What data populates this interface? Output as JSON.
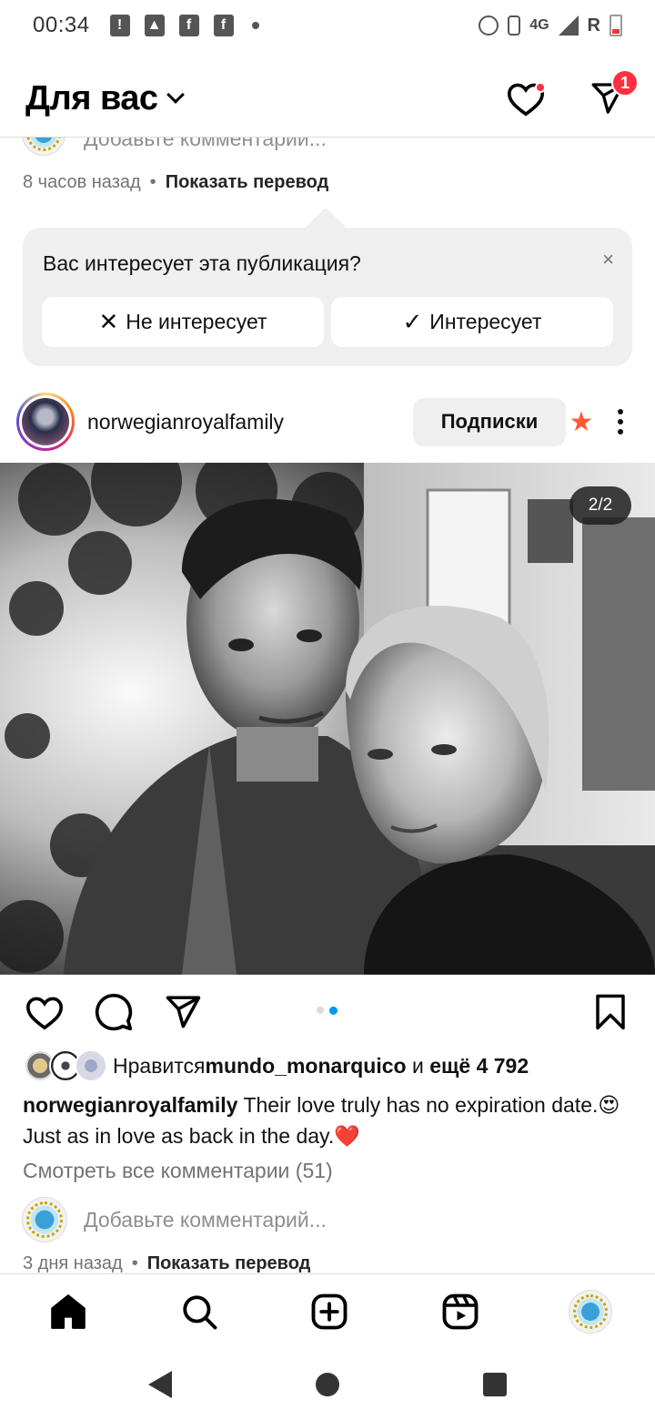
{
  "status_bar": {
    "time": "00:34",
    "network": "4G",
    "roaming": "R",
    "icons": [
      "alert-icon",
      "image-icon",
      "facebook-icon",
      "facebook-icon",
      "dot-icon",
      "alarm-icon",
      "vibrate-icon",
      "signal-icon",
      "battery-icon"
    ]
  },
  "header": {
    "title": "Для вас",
    "dm_badge": "1"
  },
  "previous_post": {
    "comment_placeholder": "Добавьте комментарий...",
    "time": "8 часов назад",
    "separator": "•",
    "translate": "Показать перевод"
  },
  "suggestion": {
    "question": "Вас интересует эта публикация?",
    "close": "×",
    "not_interested": "Не интересует",
    "interested": "Интересует",
    "not_interested_glyph": "✕",
    "interested_glyph": "✓"
  },
  "post": {
    "username": "norwegianroyalfamily",
    "follow_label": "Подписки",
    "counter": "2/2",
    "likes_prefix": "Нравится ",
    "likes_user": "mundo_monarquico",
    "likes_mid": " и ",
    "likes_rest": "ещё 4 792",
    "caption_user": "norwegianroyalfamily",
    "caption_text": " Their love truly has no expiration date.😍 Just as in love as back in the day.❤️",
    "view_comments": "Смотреть все комментарии (51)",
    "comment_placeholder": "Добавьте комментарий...",
    "time": "3 дня назад",
    "separator": "•",
    "translate": "Показать перевод",
    "carousel": {
      "count": 2,
      "active": 2
    }
  },
  "colors": {
    "accent": "#0095f6",
    "badge": "#ff3040",
    "star": "#ff5a36",
    "muted": "#737373"
  }
}
